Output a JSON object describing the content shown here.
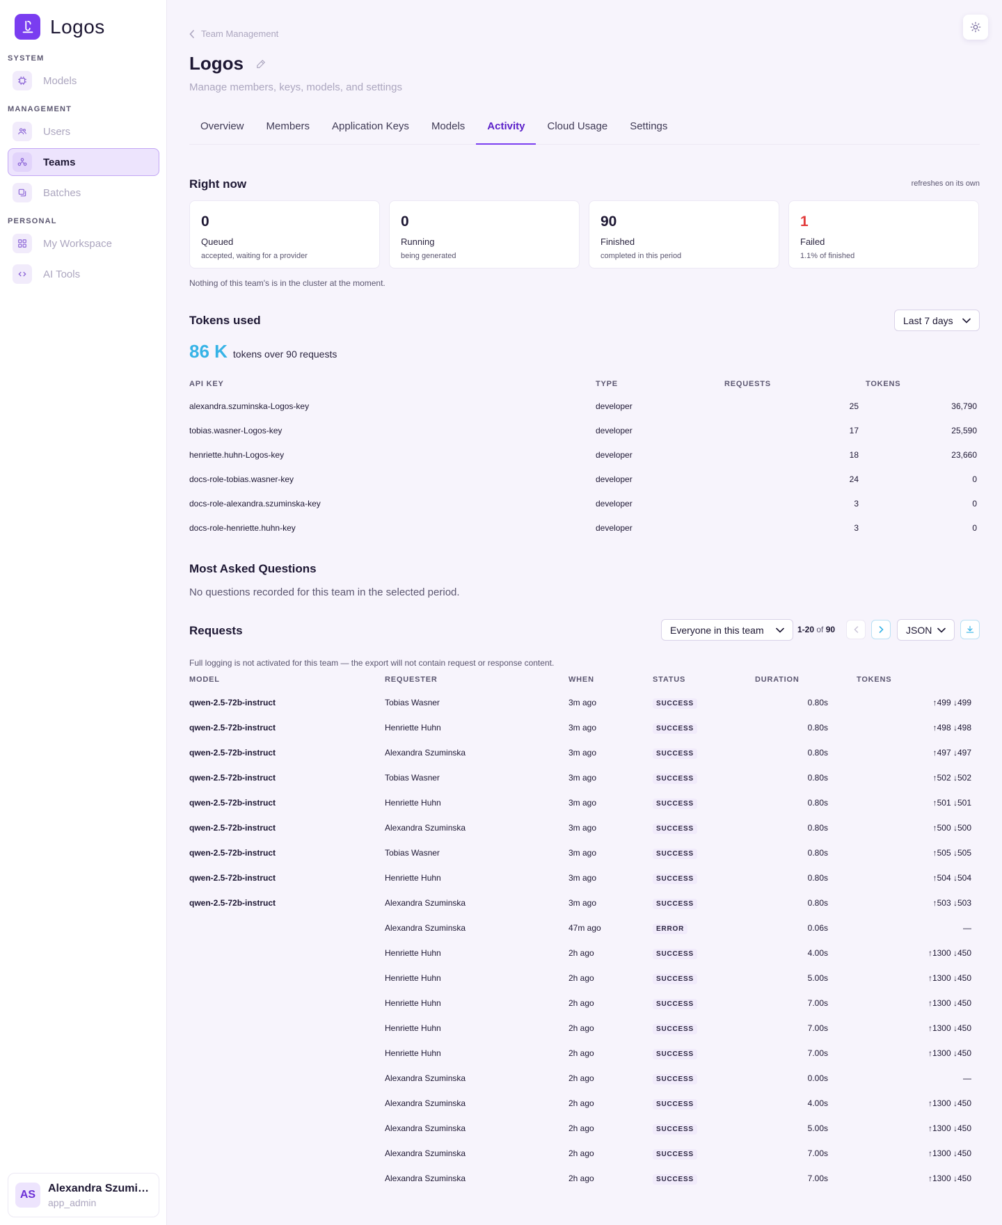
{
  "app": {
    "name": "Logos"
  },
  "sidebar": {
    "sections": [
      {
        "title": "SYSTEM",
        "items": [
          {
            "label": "Models",
            "icon": "chip-icon"
          }
        ]
      },
      {
        "title": "MANAGEMENT",
        "items": [
          {
            "label": "Users",
            "icon": "users-icon"
          },
          {
            "label": "Teams",
            "icon": "team-icon",
            "active": true
          },
          {
            "label": "Batches",
            "icon": "batches-icon"
          }
        ]
      },
      {
        "title": "PERSONAL",
        "items": [
          {
            "label": "My Workspace",
            "icon": "grid-icon"
          },
          {
            "label": "AI Tools",
            "icon": "code-icon"
          }
        ]
      }
    ],
    "user": {
      "initials": "AS",
      "name": "Alexandra Szuminska",
      "role": "app_admin"
    }
  },
  "header": {
    "breadcrumb": "Team Management",
    "title": "Logos",
    "subtitle": "Manage members, keys, models, and settings"
  },
  "tabs": [
    "Overview",
    "Members",
    "Application Keys",
    "Models",
    "Activity",
    "Cloud Usage",
    "Settings"
  ],
  "active_tab": "Activity",
  "right_now": {
    "title": "Right now",
    "refresh_note": "refreshes on its own",
    "cards": [
      {
        "value": "0",
        "label": "Queued",
        "sub": "accepted, waiting for a provider"
      },
      {
        "value": "0",
        "label": "Running",
        "sub": "being generated"
      },
      {
        "value": "90",
        "label": "Finished",
        "sub": "completed in this period"
      },
      {
        "value": "1",
        "label": "Failed",
        "sub": "1.1% of finished",
        "color": "#e23b3b"
      }
    ],
    "note": "Nothing of this team's is in the cluster at the moment."
  },
  "tokens_used": {
    "title": "Tokens used",
    "period": "Last 7 days",
    "total": "86 K",
    "total_text": "tokens over 90 requests",
    "headers": [
      "API KEY",
      "TYPE",
      "REQUESTS",
      "TOKENS"
    ],
    "rows": [
      {
        "key": "alexandra.szuminska-Logos-key",
        "type": "developer",
        "requests": "25",
        "tokens": "36,790"
      },
      {
        "key": "tobias.wasner-Logos-key",
        "type": "developer",
        "requests": "17",
        "tokens": "25,590"
      },
      {
        "key": "henriette.huhn-Logos-key",
        "type": "developer",
        "requests": "18",
        "tokens": "23,660"
      },
      {
        "key": "docs-role-tobias.wasner-key",
        "type": "developer",
        "requests": "24",
        "tokens": "0"
      },
      {
        "key": "docs-role-alexandra.szuminska-key",
        "type": "developer",
        "requests": "3",
        "tokens": "0"
      },
      {
        "key": "docs-role-henriette.huhn-key",
        "type": "developer",
        "requests": "3",
        "tokens": "0"
      }
    ]
  },
  "questions": {
    "title": "Most Asked Questions",
    "empty": "No questions recorded for this team in the selected period."
  },
  "requests": {
    "title": "Requests",
    "filter": "Everyone in this team",
    "range": "1-20",
    "of": "of",
    "total": "90",
    "format": "JSON",
    "notice": "Full logging is not activated for this team — the export will not contain request or response content.",
    "headers": [
      "MODEL",
      "REQUESTER",
      "WHEN",
      "STATUS",
      "DURATION",
      "TOKENS"
    ],
    "rows": [
      {
        "model": "qwen-2.5-72b-instruct",
        "requester": "Tobias Wasner",
        "when": "3m ago",
        "status": "SUCCESS",
        "duration": "0.80s",
        "tokens": "↑499 ↓499"
      },
      {
        "model": "qwen-2.5-72b-instruct",
        "requester": "Henriette Huhn",
        "when": "3m ago",
        "status": "SUCCESS",
        "duration": "0.80s",
        "tokens": "↑498 ↓498"
      },
      {
        "model": "qwen-2.5-72b-instruct",
        "requester": "Alexandra Szuminska",
        "when": "3m ago",
        "status": "SUCCESS",
        "duration": "0.80s",
        "tokens": "↑497 ↓497"
      },
      {
        "model": "qwen-2.5-72b-instruct",
        "requester": "Tobias Wasner",
        "when": "3m ago",
        "status": "SUCCESS",
        "duration": "0.80s",
        "tokens": "↑502 ↓502"
      },
      {
        "model": "qwen-2.5-72b-instruct",
        "requester": "Henriette Huhn",
        "when": "3m ago",
        "status": "SUCCESS",
        "duration": "0.80s",
        "tokens": "↑501 ↓501"
      },
      {
        "model": "qwen-2.5-72b-instruct",
        "requester": "Alexandra Szuminska",
        "when": "3m ago",
        "status": "SUCCESS",
        "duration": "0.80s",
        "tokens": "↑500 ↓500"
      },
      {
        "model": "qwen-2.5-72b-instruct",
        "requester": "Tobias Wasner",
        "when": "3m ago",
        "status": "SUCCESS",
        "duration": "0.80s",
        "tokens": "↑505 ↓505"
      },
      {
        "model": "qwen-2.5-72b-instruct",
        "requester": "Henriette Huhn",
        "when": "3m ago",
        "status": "SUCCESS",
        "duration": "0.80s",
        "tokens": "↑504 ↓504"
      },
      {
        "model": "qwen-2.5-72b-instruct",
        "requester": "Alexandra Szuminska",
        "when": "3m ago",
        "status": "SUCCESS",
        "duration": "0.80s",
        "tokens": "↑503 ↓503"
      },
      {
        "model": "",
        "requester": "Alexandra Szuminska",
        "when": "47m ago",
        "status": "ERROR",
        "duration": "0.06s",
        "tokens": "—"
      },
      {
        "model": "",
        "requester": "Henriette Huhn",
        "when": "2h ago",
        "status": "SUCCESS",
        "duration": "4.00s",
        "tokens": "↑1300 ↓450"
      },
      {
        "model": "",
        "requester": "Henriette Huhn",
        "when": "2h ago",
        "status": "SUCCESS",
        "duration": "5.00s",
        "tokens": "↑1300 ↓450"
      },
      {
        "model": "",
        "requester": "Henriette Huhn",
        "when": "2h ago",
        "status": "SUCCESS",
        "duration": "7.00s",
        "tokens": "↑1300 ↓450"
      },
      {
        "model": "",
        "requester": "Henriette Huhn",
        "when": "2h ago",
        "status": "SUCCESS",
        "duration": "7.00s",
        "tokens": "↑1300 ↓450"
      },
      {
        "model": "",
        "requester": "Henriette Huhn",
        "when": "2h ago",
        "status": "SUCCESS",
        "duration": "7.00s",
        "tokens": "↑1300 ↓450"
      },
      {
        "model": "",
        "requester": "Alexandra Szuminska",
        "when": "2h ago",
        "status": "SUCCESS",
        "duration": "0.00s",
        "tokens": "—"
      },
      {
        "model": "",
        "requester": "Alexandra Szuminska",
        "when": "2h ago",
        "status": "SUCCESS",
        "duration": "4.00s",
        "tokens": "↑1300 ↓450"
      },
      {
        "model": "",
        "requester": "Alexandra Szuminska",
        "when": "2h ago",
        "status": "SUCCESS",
        "duration": "5.00s",
        "tokens": "↑1300 ↓450"
      },
      {
        "model": "",
        "requester": "Alexandra Szuminska",
        "when": "2h ago",
        "status": "SUCCESS",
        "duration": "7.00s",
        "tokens": "↑1300 ↓450"
      },
      {
        "model": "",
        "requester": "Alexandra Szuminska",
        "when": "2h ago",
        "status": "SUCCESS",
        "duration": "7.00s",
        "tokens": "↑1300 ↓450"
      }
    ]
  },
  "colors": {
    "accent": "#7a3df0",
    "highlight": "#36b3e6",
    "error": "#e23b3b"
  }
}
